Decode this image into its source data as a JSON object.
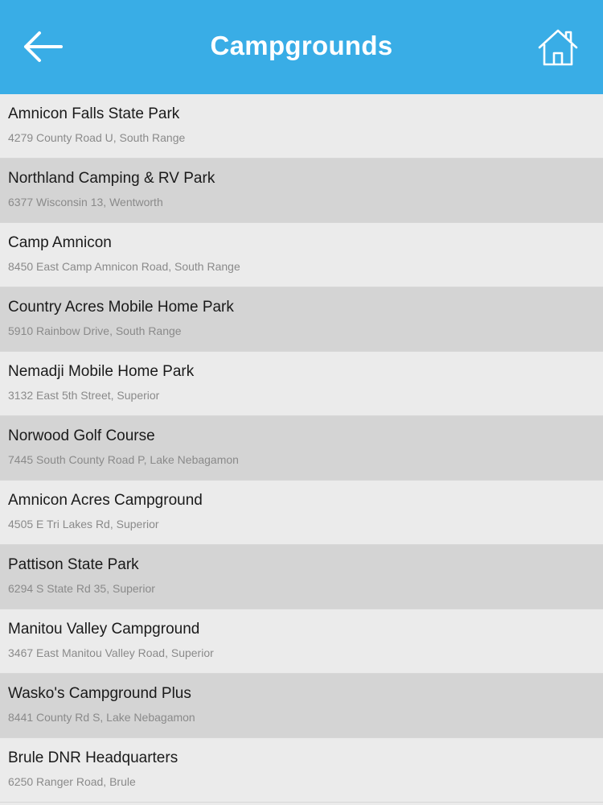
{
  "header": {
    "title": "Campgrounds",
    "back_icon": "arrow-left-icon",
    "home_icon": "home-icon",
    "background_color": "#39ade6"
  },
  "campgrounds": [
    {
      "name": "Amnicon Falls State Park",
      "address": "4279 County Road U, South Range"
    },
    {
      "name": "Northland Camping & RV Park",
      "address": "6377 Wisconsin 13, Wentworth"
    },
    {
      "name": "Camp Amnicon",
      "address": "8450 East Camp Amnicon Road, South Range"
    },
    {
      "name": "Country Acres Mobile Home Park",
      "address": "5910 Rainbow Drive, South Range"
    },
    {
      "name": "Nemadji Mobile Home Park",
      "address": "3132 East 5th Street, Superior"
    },
    {
      "name": "Norwood Golf Course",
      "address": "7445 South County Road P, Lake Nebagamon"
    },
    {
      "name": "Amnicon Acres Campground",
      "address": "4505 E Tri Lakes Rd, Superior"
    },
    {
      "name": "Pattison State Park",
      "address": "6294 S State Rd 35, Superior"
    },
    {
      "name": "Manitou Valley Campground",
      "address": "3467 East Manitou Valley Road, Superior"
    },
    {
      "name": "Wasko's Campground Plus",
      "address": "8441 County Rd S, Lake Nebagamon"
    },
    {
      "name": "Brule DNR Headquarters",
      "address": "6250 Ranger Road, Brule"
    }
  ]
}
